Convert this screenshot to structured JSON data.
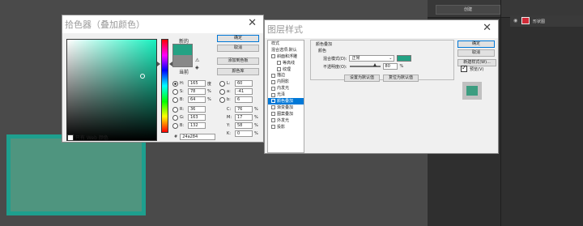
{
  "colors": {
    "new_color": "#24a284",
    "current_color": "#888888",
    "hue_top": "#19f0bf",
    "shape_fill": "#4f957f",
    "shape_stroke": "#1e9f8e",
    "selection_blue": "#0078d7"
  },
  "picker": {
    "title": "拾色器（叠加颜色）",
    "new_label": "新的",
    "current_label": "当前",
    "ok": "确定",
    "cancel": "取消",
    "add_swatch": "添加到色板",
    "color_library": "颜色库",
    "web_only": "只有 Web 颜色",
    "hex_label": "#",
    "hex_value": "24a284",
    "fields": [
      {
        "label": "H:",
        "value": "165",
        "unit": "度",
        "selected": true
      },
      {
        "label": "S:",
        "value": "78",
        "unit": "%",
        "selected": false
      },
      {
        "label": "B:",
        "value": "64",
        "unit": "%",
        "selected": false
      },
      {
        "label": "R:",
        "value": "36",
        "unit": "",
        "selected": false
      },
      {
        "label": "G:",
        "value": "163",
        "unit": "",
        "selected": false
      },
      {
        "label": "B:",
        "value": "132",
        "unit": "",
        "selected": false
      }
    ],
    "lab_fields": [
      {
        "label": "L:",
        "value": "60"
      },
      {
        "label": "a:",
        "value": "-41"
      },
      {
        "label": "b:",
        "value": "6"
      }
    ],
    "cmyk_fields": [
      {
        "label": "C:",
        "value": "76",
        "unit": "%"
      },
      {
        "label": "M:",
        "value": "17",
        "unit": "%"
      },
      {
        "label": "Y:",
        "value": "58",
        "unit": "%"
      },
      {
        "label": "K:",
        "value": "0",
        "unit": "%"
      }
    ]
  },
  "style_dialog": {
    "title": "图层样式",
    "list": [
      {
        "label": "样式",
        "checkbox": false,
        "indent": false,
        "selected": false
      },
      {
        "label": "混合选项:默认",
        "checkbox": false,
        "indent": false,
        "selected": false
      },
      {
        "label": "斜面和浮雕",
        "checkbox": true,
        "indent": false,
        "selected": false
      },
      {
        "label": "等高线",
        "checkbox": true,
        "indent": true,
        "selected": false
      },
      {
        "label": "纹理",
        "checkbox": true,
        "indent": true,
        "selected": false
      },
      {
        "label": "描边",
        "checkbox": true,
        "indent": false,
        "selected": false
      },
      {
        "label": "内阴影",
        "checkbox": true,
        "indent": false,
        "selected": false
      },
      {
        "label": "内发光",
        "checkbox": true,
        "indent": false,
        "selected": false
      },
      {
        "label": "光泽",
        "checkbox": true,
        "indent": false,
        "selected": false
      },
      {
        "label": "颜色叠加",
        "checkbox": true,
        "indent": false,
        "selected": true
      },
      {
        "label": "渐变叠加",
        "checkbox": true,
        "indent": false,
        "selected": false
      },
      {
        "label": "图案叠加",
        "checkbox": true,
        "indent": false,
        "selected": false
      },
      {
        "label": "外发光",
        "checkbox": true,
        "indent": false,
        "selected": false
      },
      {
        "label": "投影",
        "checkbox": true,
        "indent": false,
        "selected": false
      }
    ],
    "section_title": "颜色叠加",
    "subsection": "颜色",
    "blend_label": "混合模式(D):",
    "blend_value": "正常",
    "opacity_label": "不透明度(O):",
    "opacity_value": "80",
    "opacity_unit": "%",
    "set_default": "设置为默认值",
    "reset_default": "复位为默认值",
    "ok": "确定",
    "cancel": "取消",
    "new_style": "新建样式(W)...",
    "preview": "预览(V)"
  },
  "ps_panel": {
    "top_button": "创建",
    "layer_name": "形状图"
  }
}
